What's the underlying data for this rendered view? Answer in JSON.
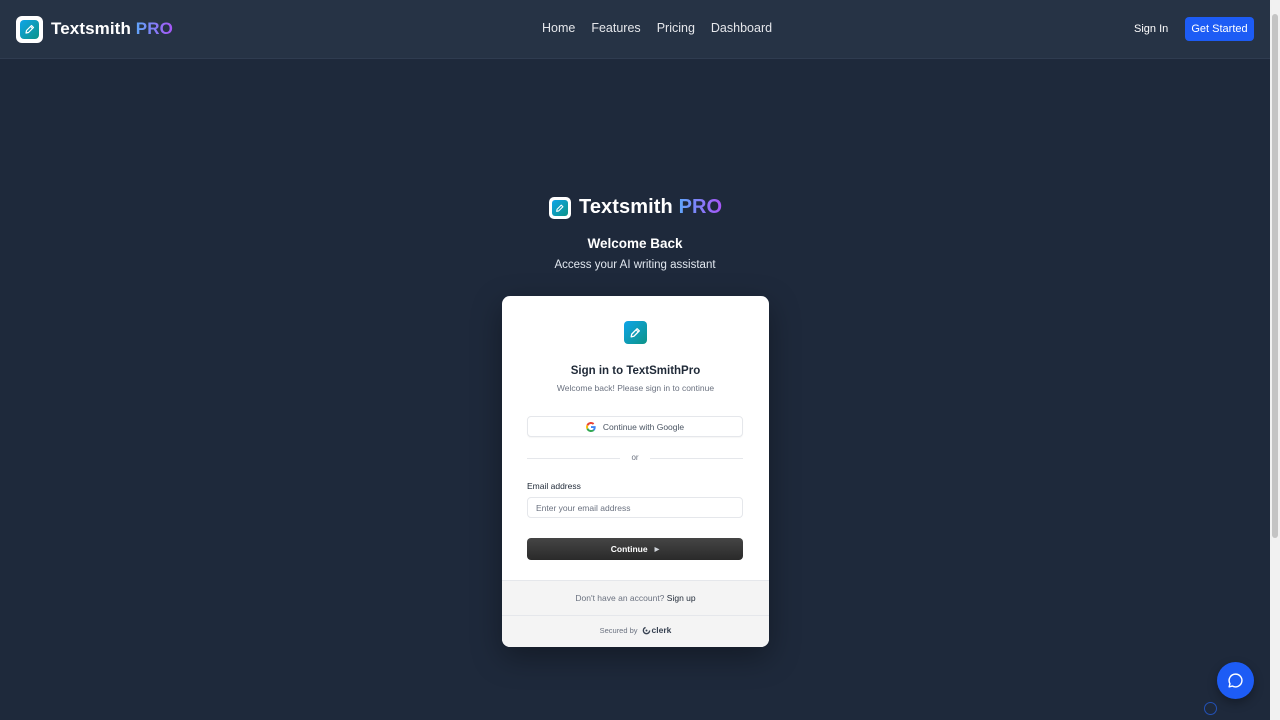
{
  "nav": {
    "brand_name": "Textsmith",
    "brand_suffix": "PRO",
    "links": [
      "Home",
      "Features",
      "Pricing",
      "Dashboard"
    ],
    "sign_in": "Sign In",
    "get_started": "Get Started"
  },
  "hero": {
    "brand_name": "Textsmith",
    "brand_suffix": "PRO",
    "welcome": "Welcome Back",
    "subtitle": "Access your AI writing assistant"
  },
  "card": {
    "title": "Sign in to TextSmithPro",
    "subtitle": "Welcome back! Please sign in to continue",
    "google_button": "Continue with Google",
    "divider": "or",
    "email_label": "Email address",
    "email_placeholder": "Enter your email address",
    "email_value": "",
    "continue_button": "Continue",
    "no_account": "Don't have an account?",
    "sign_up": "Sign up",
    "secured_by": "Secured by",
    "provider": "clerk"
  },
  "icons": {
    "brand": "pencil-icon",
    "google": "google-icon",
    "continue": "caret-right-icon",
    "chat": "chat-bubble-icon"
  },
  "colors": {
    "background": "#1e293b",
    "navbar": "#263345",
    "primary_button": "#1d5cf5",
    "pro_gradient_start": "#60a5fa",
    "pro_gradient_end": "#a855f7"
  }
}
